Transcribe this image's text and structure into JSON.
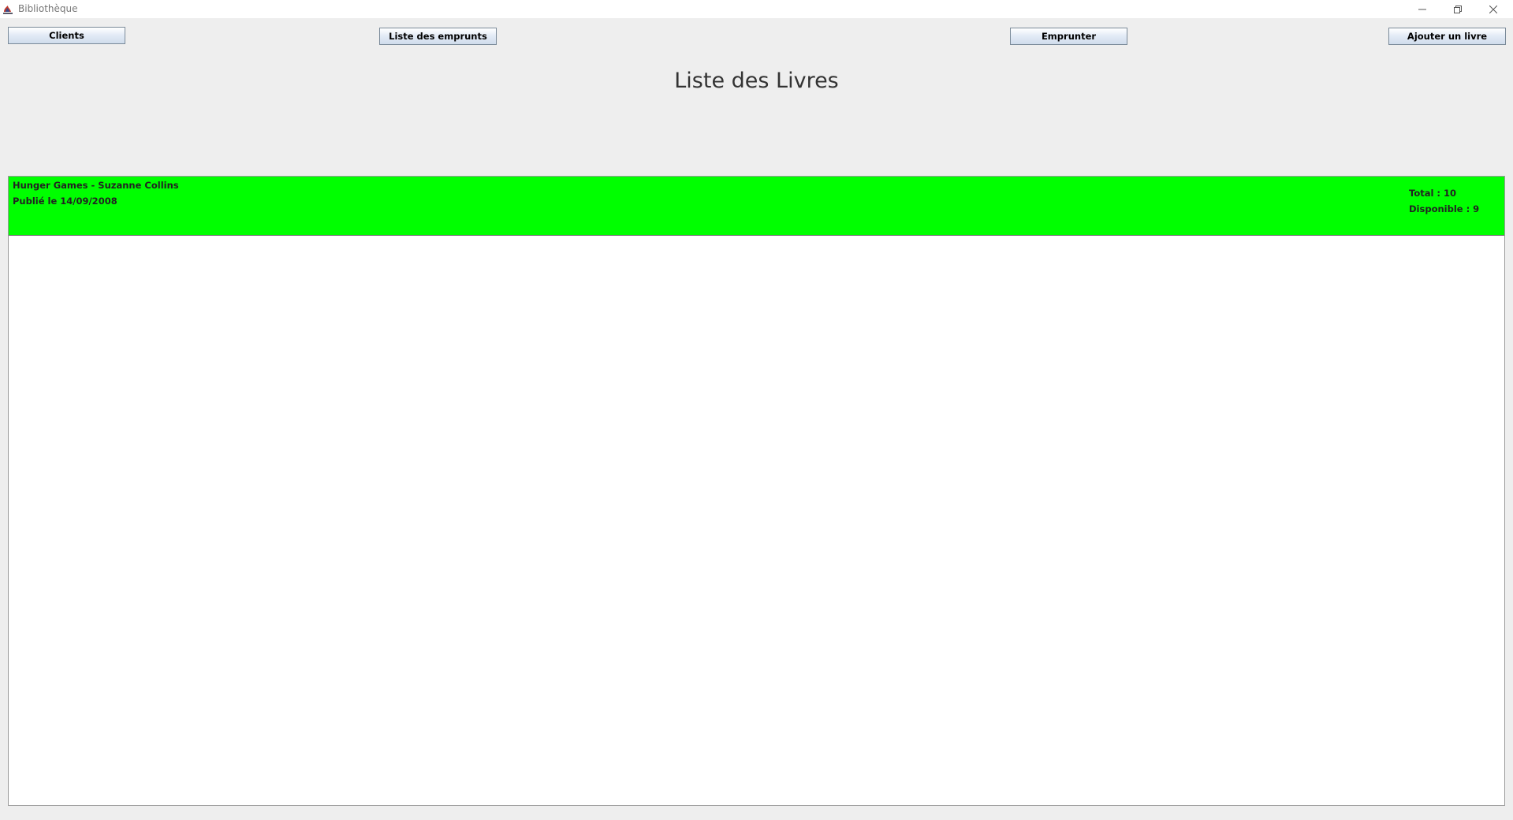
{
  "window": {
    "title": "Bibliothèque",
    "icon": "java-app-icon",
    "controls": [
      "minimize-icon",
      "restore-icon",
      "close-icon"
    ]
  },
  "toolbar": {
    "clients_label": "Clients",
    "emprunts_label": "Liste des emprunts",
    "emprunter_label": "Emprunter",
    "ajouter_label": "Ajouter un livre"
  },
  "main": {
    "title": "Liste des Livres"
  },
  "books": [
    {
      "title_line": "Hunger Games - Suzanne Collins",
      "published_line": "Publié le 14/09/2008",
      "total_line": "Total : 10",
      "available_line": "Disponible : 9",
      "row_color": "#00ff00"
    }
  ],
  "colors": {
    "background": "#eeeeee",
    "list_background": "#ffffff",
    "available_row": "#00ff00"
  }
}
